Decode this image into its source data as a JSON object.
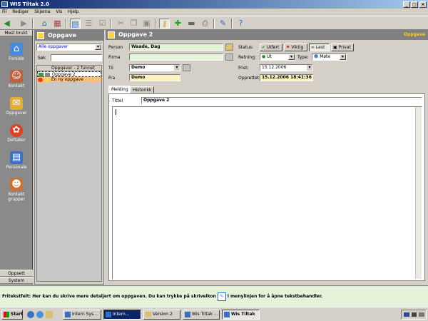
{
  "app": {
    "title": "WIS Tiltak 2.0"
  },
  "menu": [
    "Fil",
    "Rediger",
    "Skjema",
    "Vis",
    "Hjelp"
  ],
  "sidebar": {
    "header": "Mest brukt",
    "items": [
      {
        "label": "Forside",
        "icon": "house-icon"
      },
      {
        "label": "Kontakt",
        "icon": "people-icon"
      },
      {
        "label": "Oppgaver",
        "icon": "task-icon"
      },
      {
        "label": "Deltaker",
        "icon": "flower-icon"
      },
      {
        "label": "Personale",
        "icon": "id-card-icon"
      },
      {
        "label": "Kontakt grupper",
        "icon": "group-icon"
      }
    ],
    "bottom": [
      "Oppsett",
      "System"
    ]
  },
  "tasklist": {
    "header": "Oppgave",
    "filter": "Alle oppgaver",
    "search_label": "Søk",
    "list_header": "Oppgaver - 2 funnet",
    "items": [
      "Oppgave 2",
      "En ny oppgave"
    ]
  },
  "form": {
    "title": "Oppgave 2",
    "right_label": "Oppgave",
    "person_label": "Person",
    "person": "Waade, Dag",
    "firma_label": "Firma",
    "firma": "",
    "til_label": "Til",
    "til": "Demo",
    "fra_label": "Fra",
    "fra": "Demo",
    "status_label": "Status:",
    "status_buttons": [
      "Utført",
      "Viktig",
      "Lest",
      "Privat"
    ],
    "retning_label": "Retning:",
    "retning": "Ut",
    "type_label": "Type:",
    "type": "Møte",
    "frist_label": "Frist:",
    "frist": "15.12.2006",
    "opprettet_label": "Opprettet:",
    "opprettet": "15.12.2006 18:41:36",
    "tabs": [
      "Melding",
      "Historikk"
    ],
    "tittel_label": "Tittel",
    "tittel": "Oppgave 2"
  },
  "statusbar": {
    "text1": "Fritekstfelt: Her kan du skrive mere detaljert om oppgaven. Du kan trykke på skriveikon",
    "text2": "i menylinjen for å åpne tekstbehandler."
  },
  "taskbar": {
    "start": "Start",
    "tasks": [
      "Intern Sys...",
      "Intern...",
      "Version 2",
      "Wis Tiltak ...",
      "Wis Tiltak"
    ]
  },
  "colors": {
    "accent": "#0a246a",
    "highlight_green": "#e4f4d8",
    "highlight_yellow": "#fff4c0"
  }
}
